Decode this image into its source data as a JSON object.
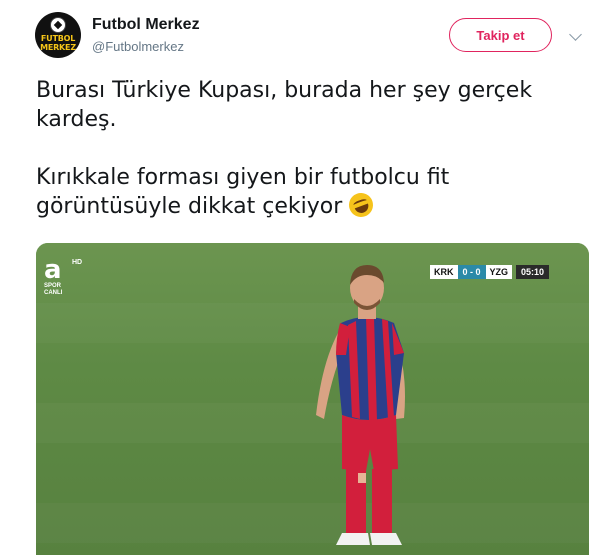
{
  "account": {
    "display_name": "Futbol Merkez",
    "handle": "@Futbolmerkez",
    "avatar_text": "FUTBOL MERKEZ"
  },
  "follow_button": {
    "label": "Takip et"
  },
  "tweet": {
    "paragraph_1": "Burası Türkiye Kupası, burada her şey gerçek kardeş.",
    "paragraph_2": "Kırıkkale forması giyen bir futbolcu fit görüntüsüyle dikkat çekiyor",
    "emoji": "rolling-on-floor-laughing-icon"
  },
  "media": {
    "channel_logo": {
      "letter": "a",
      "hd": "HD",
      "subtitle": "SPOR CANLI"
    },
    "scoreboard": {
      "home_team": "KRK",
      "score": "0 - 0",
      "away_team": "YZG",
      "clock": "05:10"
    }
  },
  "colors": {
    "accent": "#e0245e",
    "text": "#14171a",
    "secondary_text": "#657786",
    "jersey_blue": "#2b3f8c",
    "jersey_red": "#d21f3c",
    "pitch": "#5f8a46"
  }
}
